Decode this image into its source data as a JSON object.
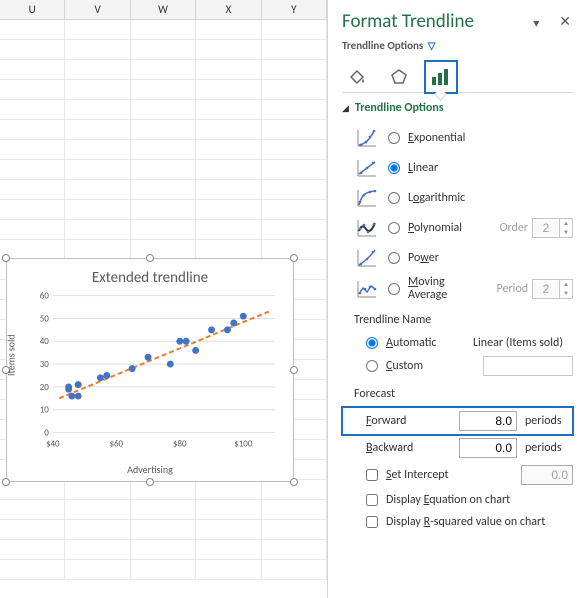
{
  "columns": [
    "U",
    "V",
    "W",
    "X",
    "Y"
  ],
  "chart": {
    "title": "Extended trendline",
    "ylabel": "Items sold",
    "xlabel": "Advertising"
  },
  "chart_data": {
    "type": "scatter",
    "title": "Extended trendline",
    "xlabel": "Advertising",
    "ylabel": "Items sold",
    "xlim": [
      40,
      110
    ],
    "ylim": [
      0,
      60
    ],
    "xticks": [
      "$40",
      "$60",
      "$80",
      "$100"
    ],
    "yticks": [
      0,
      10,
      20,
      30,
      40,
      50,
      60
    ],
    "series": [
      {
        "name": "Items sold",
        "type": "scatter",
        "points": [
          {
            "x": 45,
            "y": 20
          },
          {
            "x": 45,
            "y": 19
          },
          {
            "x": 46,
            "y": 16
          },
          {
            "x": 48,
            "y": 16
          },
          {
            "x": 48,
            "y": 21
          },
          {
            "x": 55,
            "y": 24
          },
          {
            "x": 57,
            "y": 25
          },
          {
            "x": 65,
            "y": 28
          },
          {
            "x": 70,
            "y": 33
          },
          {
            "x": 77,
            "y": 30
          },
          {
            "x": 80,
            "y": 40
          },
          {
            "x": 82,
            "y": 40
          },
          {
            "x": 85,
            "y": 36
          },
          {
            "x": 90,
            "y": 45
          },
          {
            "x": 95,
            "y": 45
          },
          {
            "x": 97,
            "y": 48
          },
          {
            "x": 100,
            "y": 51
          }
        ]
      },
      {
        "name": "Linear (Items sold)",
        "type": "trendline",
        "style": "dashed",
        "start": {
          "x": 42,
          "y": 15
        },
        "end": {
          "x": 108,
          "y": 53
        }
      }
    ]
  },
  "pane": {
    "title": "Format Trendline",
    "sub": "Trendline Options",
    "section": "Trendline Options",
    "types": {
      "exponential": "Exponential",
      "linear": "Linear",
      "logarithmic": "Logarithmic",
      "polynomial": "Polynomial",
      "power": "Power",
      "moving": "Moving\nAverage"
    },
    "order_label": "Order",
    "order_value": "2",
    "period_label": "Period",
    "period_value": "2",
    "name_head": "Trendline Name",
    "name_auto": "Automatic",
    "name_custom": "Custom",
    "name_value": "Linear (Items sold)",
    "forecast_head": "Forecast",
    "forward_label": "Forward",
    "forward_value": "8.0",
    "backward_label": "Backward",
    "backward_value": "0.0",
    "periods_unit": "periods",
    "set_intercept": "Set Intercept",
    "set_intercept_value": "0.0",
    "display_eq": "Display Equation on chart",
    "display_r2": "Display R-squared value on chart"
  }
}
